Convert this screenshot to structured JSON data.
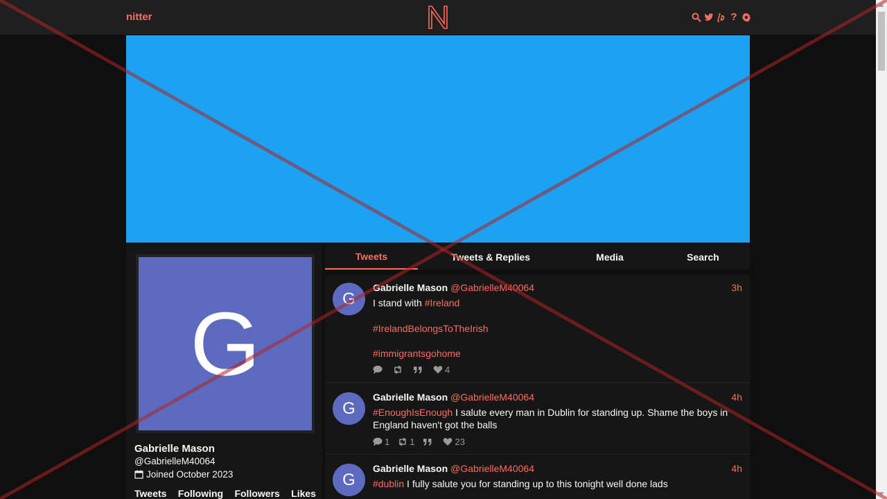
{
  "nav": {
    "brand": "nitter",
    "logo_letter": "N",
    "icons": [
      "search-icon",
      "twitter-bird-icon",
      "liberapay-icon",
      "help-icon",
      "gear-icon"
    ],
    "help_glyph": "?"
  },
  "colors": {
    "accent": "#ff6c60",
    "banner": "#1da1f2",
    "avatar": "#5c6bc0",
    "background": "#0f0f0f",
    "panel": "#161616"
  },
  "profile": {
    "avatar_letter": "G",
    "name": "Gabrielle Mason",
    "handle": "@GabrielleM40064",
    "joined": "Joined October 2023",
    "stats": [
      "Tweets",
      "Following",
      "Followers",
      "Likes"
    ]
  },
  "tabs": [
    {
      "label": "Tweets",
      "active": true
    },
    {
      "label": "Tweets & Replies",
      "active": false
    },
    {
      "label": "Media",
      "active": false
    },
    {
      "label": "Search",
      "active": false
    }
  ],
  "tweets": [
    {
      "avatar_letter": "G",
      "name": "Gabrielle Mason",
      "handle": "@GabrielleM40064",
      "time": "3h",
      "lines": [
        {
          "text": "I stand with ",
          "tag": "#Ireland"
        },
        {
          "text": "",
          "tag": "#IrelandBelongsToTheIrish"
        },
        {
          "text": "",
          "tag": "#immigrantsgohome"
        }
      ],
      "replies": "",
      "retweets": "",
      "quotes": "",
      "likes": "4"
    },
    {
      "avatar_letter": "G",
      "name": "Gabrielle Mason",
      "handle": "@GabrielleM40064",
      "time": "4h",
      "tag": "#EnoughIsEnough",
      "text": " I salute every man in Dublin for standing up. Shame the boys in England haven't got the balls",
      "replies": "1",
      "retweets": "1",
      "quotes": "",
      "likes": "23"
    },
    {
      "avatar_letter": "G",
      "name": "Gabrielle Mason",
      "handle": "@GabrielleM40064",
      "time": "4h",
      "tag": "#dublin",
      "text": " I fully salute you for standing up to this tonight well done lads"
    }
  ]
}
